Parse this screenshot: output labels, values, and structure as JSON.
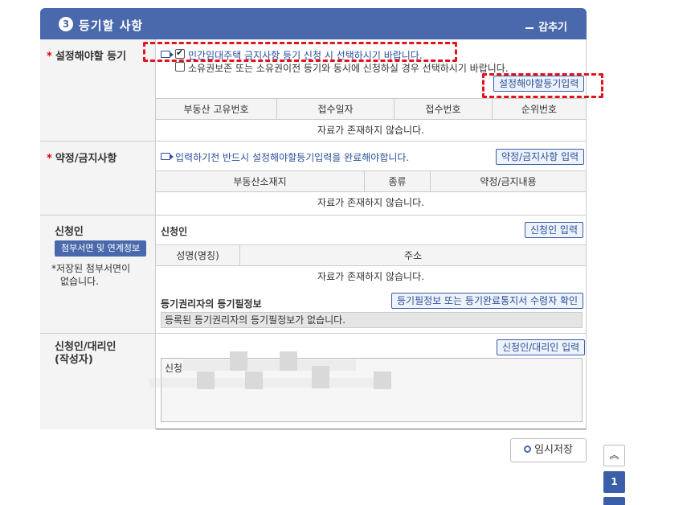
{
  "header": {
    "step_number": "3",
    "title": "등기할 사항",
    "collapse_label": "감추기"
  },
  "section_registration": {
    "label": "설정해야할 등기",
    "checkbox1_label": "민간임대주택 금지사항 등기 신청 시 선택하시기 바랍니다.",
    "checkbox1_checked": true,
    "checkbox2_label": "소유권보존 또는 소유권이전 등기와 동시에 신청하실 경우 선택하시기 바랍니다.",
    "checkbox2_checked": false,
    "input_button": "설정해야할등기입력",
    "columns": [
      "부동산 고유번호",
      "접수일자",
      "접수번호",
      "순위번호"
    ],
    "empty_text": "자료가 존재하지 않습니다."
  },
  "section_agreement": {
    "label": "약정/금지사항",
    "notice": "입력하기전 반드시 설정해야할등기입력을 완료해야합니다.",
    "input_button": "약정/금지사항 입력",
    "columns": [
      "부동산소재지",
      "종류",
      "약정/금지내용"
    ],
    "empty_text": "자료가 존재하지 않습니다."
  },
  "section_applicant": {
    "label": "신청인",
    "attach_button": "첨부서면 및 연계정보",
    "note_star": "*",
    "note_line1": "저장된 첨부서면이",
    "note_line2": "없습니다.",
    "sub_title": "신청인",
    "input_button": "신청인 입력",
    "columns": [
      "성명(명칭)",
      "주소"
    ],
    "empty_text": "자료가 존재하지 않습니다.",
    "rights_title": "등기권리자의 등기필정보",
    "rights_button": "등기필정보 또는 등기완료통지서 수령자 확인",
    "rights_text": "등록된 등기권리자의 등기필정보가 없습니다."
  },
  "section_agent": {
    "label_line1": "신청인/대리인",
    "label_line2": "(작성자)",
    "input_button": "신청인/대리인 입력",
    "textarea_prefix": "신청"
  },
  "footer": {
    "save_label": "임시저장",
    "top_label": "︽",
    "page_label": "1"
  },
  "colors": {
    "header_bg": "#4a69ad",
    "button_border": "#3a5ea8",
    "highlight_dashed": "#e0141e",
    "required_star": "#dd0000"
  }
}
